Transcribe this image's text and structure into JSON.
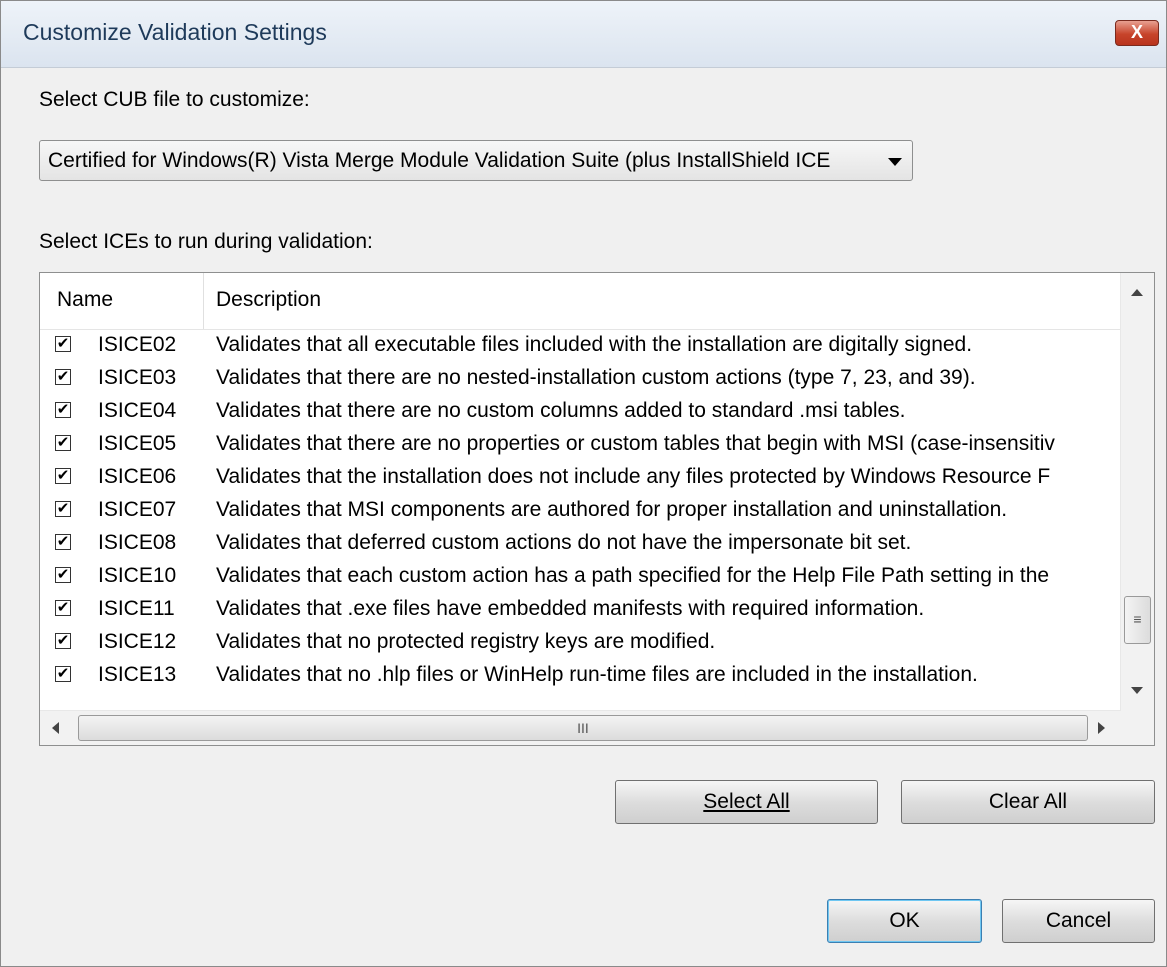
{
  "window": {
    "title": "Customize Validation Settings",
    "close_label": "X"
  },
  "cub": {
    "label": "Select CUB file to customize:",
    "selected": "Certified for Windows(R) Vista Merge Module Validation Suite (plus InstallShield ICE"
  },
  "ices": {
    "label": "Select ICEs to run during validation:",
    "columns": {
      "name": "Name",
      "description": "Description"
    },
    "rows": [
      {
        "name": "ISICE02",
        "desc": "Validates that all executable files included with the installation are digitally signed."
      },
      {
        "name": "ISICE03",
        "desc": "Validates that there are no nested-installation custom actions (type 7, 23, and 39)."
      },
      {
        "name": "ISICE04",
        "desc": "Validates that there are no custom columns added to standard .msi tables."
      },
      {
        "name": "ISICE05",
        "desc": "Validates that there are no properties or custom tables that begin with MSI (case-insensitiv"
      },
      {
        "name": "ISICE06",
        "desc": "Validates that the installation does not include any files protected by Windows Resource F"
      },
      {
        "name": "ISICE07",
        "desc": "Validates that MSI components are authored for proper installation and uninstallation."
      },
      {
        "name": "ISICE08",
        "desc": "Validates that deferred custom actions do not have the impersonate bit set."
      },
      {
        "name": "ISICE10",
        "desc": "Validates that each custom action has a path specified for the Help File Path setting in the"
      },
      {
        "name": "ISICE11",
        "desc": "Validates that .exe files have embedded manifests with required information."
      },
      {
        "name": "ISICE12",
        "desc": "Validates that no protected registry keys are modified."
      },
      {
        "name": "ISICE13",
        "desc": "Validates that no .hlp files or WinHelp run-time files are included in the installation."
      }
    ],
    "checked": "✔",
    "hscroll_grip": "III",
    "vscroll_grip": "≡"
  },
  "buttons": {
    "select_all": "Select All",
    "clear_all": "Clear All",
    "ok": "OK",
    "cancel": "Cancel"
  }
}
